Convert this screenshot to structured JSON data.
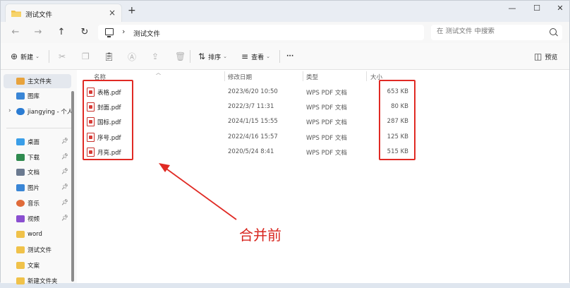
{
  "window": {
    "tab_title": "测试文件",
    "tab_close": "×",
    "new_tab": "+",
    "minimize": "—",
    "maximize": "☐",
    "close": "✕"
  },
  "address": {
    "back": "←",
    "forward": "→",
    "up": "↑",
    "refresh": "↻",
    "separator": "›",
    "path": "测试文件",
    "search_placeholder": "在 测试文件 中搜索"
  },
  "toolbar": {
    "new_label": "新建",
    "sort_label": "排序",
    "view_label": "查看",
    "more_label": "···",
    "preview_label": "预览"
  },
  "sidebar": {
    "items": [
      {
        "label": "主文件夹",
        "icon": "home-icon",
        "color": "#e8a33d"
      },
      {
        "label": "图库",
        "icon": "gallery-icon",
        "color": "#3a86d6"
      },
      {
        "label": "jiangying - 个人",
        "icon": "cloud-icon",
        "color": "#2b7cd3"
      },
      {
        "label": "桌面",
        "icon": "desktop-icon",
        "color": "#3a9ee8"
      },
      {
        "label": "下载",
        "icon": "download-icon",
        "color": "#2f8a4f"
      },
      {
        "label": "文档",
        "icon": "document-icon",
        "color": "#6b7a90"
      },
      {
        "label": "图片",
        "icon": "pictures-icon",
        "color": "#3a86d6"
      },
      {
        "label": "音乐",
        "icon": "music-icon",
        "color": "#e06b3a"
      },
      {
        "label": "视频",
        "icon": "video-icon",
        "color": "#8a4fd0"
      },
      {
        "label": "word",
        "icon": "folder-icon",
        "color": "#f0c24a"
      },
      {
        "label": "测试文件",
        "icon": "folder-icon",
        "color": "#f0c24a"
      },
      {
        "label": "文案",
        "icon": "folder-icon",
        "color": "#f0c24a"
      },
      {
        "label": "新建文件夹",
        "icon": "folder-icon",
        "color": "#f0c24a"
      }
    ]
  },
  "columns": {
    "name": "名称",
    "date": "修改日期",
    "type": "类型",
    "size": "大小"
  },
  "files": [
    {
      "name": "表格.pdf",
      "date": "2023/6/20 10:50",
      "type": "WPS PDF 文档",
      "size": "653 KB"
    },
    {
      "name": "封面.pdf",
      "date": "2022/3/7 11:31",
      "type": "WPS PDF 文档",
      "size": "80 KB"
    },
    {
      "name": "国标.pdf",
      "date": "2024/1/15 15:55",
      "type": "WPS PDF 文档",
      "size": "287 KB"
    },
    {
      "name": "序号.pdf",
      "date": "2022/4/16 15:57",
      "type": "WPS PDF 文档",
      "size": "125 KB"
    },
    {
      "name": "月亮.pdf",
      "date": "2020/5/24 8:41",
      "type": "WPS PDF 文档",
      "size": "515 KB"
    }
  ],
  "annotation": "合并前",
  "colors": {
    "highlight": "#e02a24",
    "annotation": "#d8261f",
    "accent": "#0067c0"
  }
}
